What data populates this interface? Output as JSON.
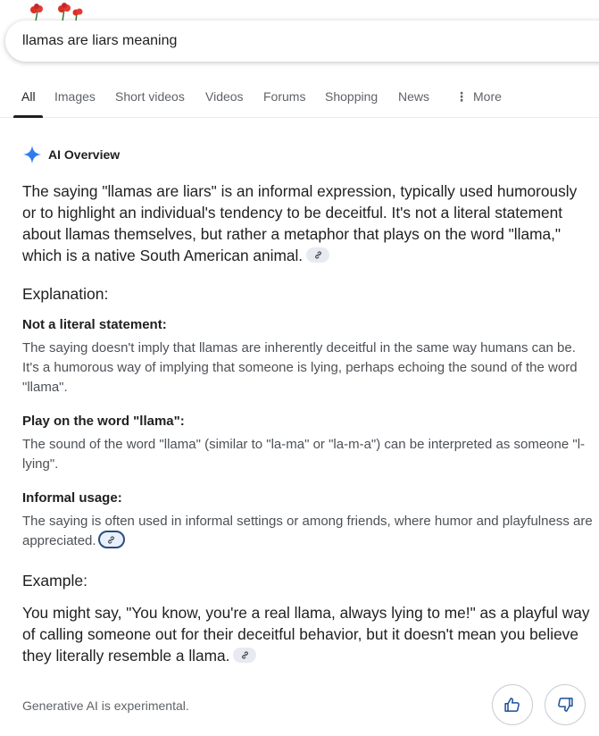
{
  "search": {
    "query": "llamas are liars meaning"
  },
  "tabs": [
    {
      "label": "All"
    },
    {
      "label": "Images"
    },
    {
      "label": "Short videos"
    },
    {
      "label": "Videos"
    },
    {
      "label": "Forums"
    },
    {
      "label": "Shopping"
    },
    {
      "label": "News"
    },
    {
      "label": "More"
    }
  ],
  "ai_overview": {
    "title": "AI Overview",
    "lead": "The saying \"llamas are liars\" is an informal expression, typically used humorously or to highlight an individual's tendency to be deceitful. It's not a literal statement about llamas themselves, but rather a metaphor that plays on the word \"llama,\" which is a native South American animal.",
    "explanation_heading": "Explanation:",
    "points": [
      {
        "heading": "Not a literal statement:",
        "text": "The saying doesn't imply that llamas are inherently deceitful in the same way humans can be. It's a humorous way of implying that someone is lying, perhaps echoing the sound of the word \"llama\"."
      },
      {
        "heading": "Play on the word \"llama\":",
        "text": "The sound of the word \"llama\" (similar to \"la-ma\" or \"la-m-a\") can be interpreted as someone \"l-lying\"."
      },
      {
        "heading": "Informal usage:",
        "text": "The saying is often used in informal settings or among friends, where humor and playfulness are appreciated."
      }
    ],
    "example_heading": "Example:",
    "example": "You might say, \"You know, you're a real llama, always lying to me!\" as a playful way of calling someone out for their deceitful behavior, but it doesn't mean you believe they literally resemble a llama."
  },
  "footer": {
    "note": "Generative AI is experimental."
  },
  "icons": {
    "sparkle": "ai-sparkle-icon",
    "link": "link-icon",
    "thumbs_up": "thumbs-up-icon",
    "thumbs_down": "thumbs-down-icon",
    "more": "more-vert-icon"
  },
  "colors": {
    "sparkle": "#4285f4",
    "chip_bg": "#e8eaf1",
    "chip_focus_border": "#2b4c7e",
    "secondary_text": "#4d5156"
  }
}
